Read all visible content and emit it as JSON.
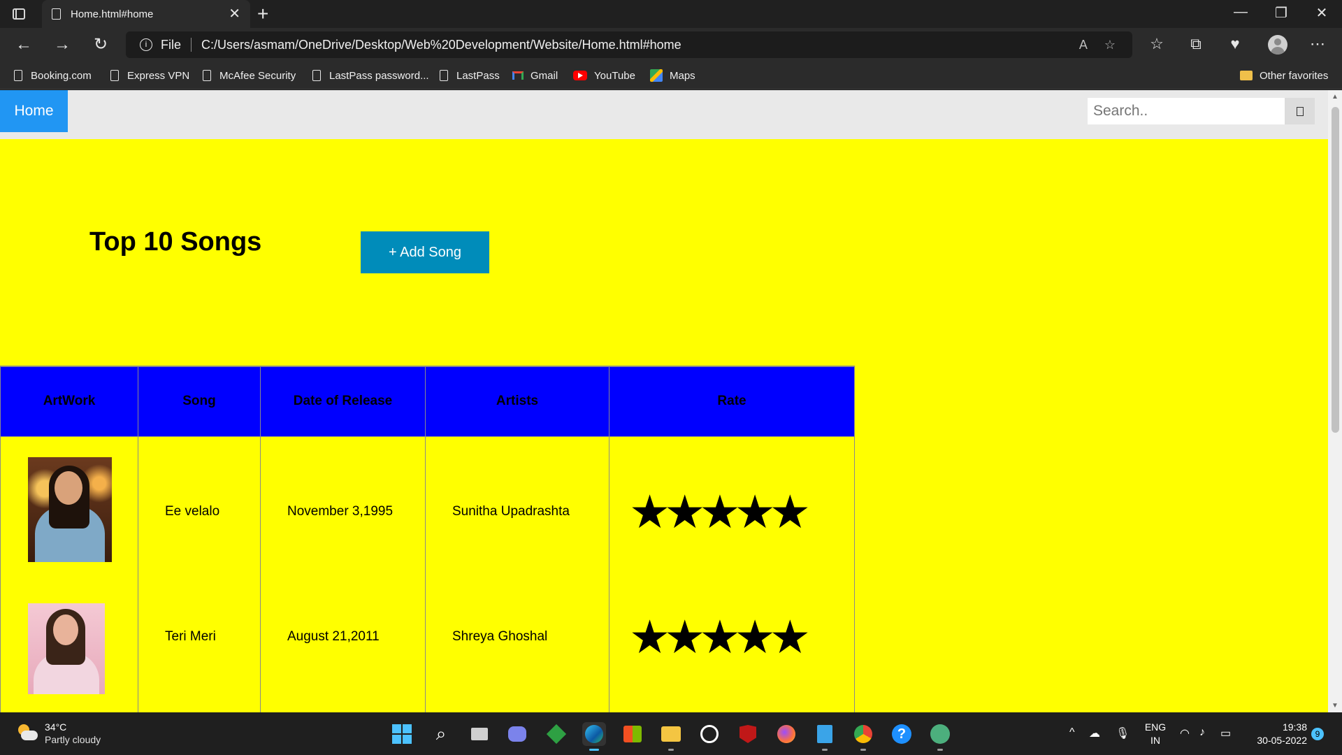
{
  "browser": {
    "tab_title": "Home.html#home",
    "tab_close": "✕",
    "new_tab": "+",
    "address_scheme": "File",
    "address_url": "C:/Users/asmam/OneDrive/Desktop/Web%20Development/Website/Home.html#home",
    "window_controls": [
      "—",
      "❐",
      "✕"
    ],
    "nav_icons": [
      "back-icon",
      "forward-icon",
      "refresh-icon"
    ],
    "favorites": [
      {
        "label": "Booking.com",
        "icon": "page-icon"
      },
      {
        "label": "Express VPN",
        "icon": "page-icon"
      },
      {
        "label": "McAfee Security",
        "icon": "page-icon"
      },
      {
        "label": "LastPass password...",
        "icon": "page-icon"
      },
      {
        "label": "LastPass",
        "icon": "page-icon"
      },
      {
        "label": "Gmail",
        "icon": "gmail-icon"
      },
      {
        "label": "YouTube",
        "icon": "youtube-icon"
      },
      {
        "label": "Maps",
        "icon": "maps-icon"
      }
    ],
    "other_favorites": "Other favorites"
  },
  "page": {
    "nav": {
      "home": "Home",
      "search_placeholder": "Search.."
    },
    "heading": "Top 10 Songs",
    "add_button": "+ Add Song",
    "table": {
      "headers": [
        "ArtWork",
        "Song",
        "Date of Release",
        "Artists",
        "Rate"
      ],
      "rows": [
        {
          "song": "Ee velalo",
          "date": "November 3,1995",
          "artist": "Sunitha Upadrashta",
          "rating": 5
        },
        {
          "song": "Teri Meri",
          "date": "August 21,2011",
          "artist": "Shreya Ghoshal",
          "rating": 5
        }
      ]
    }
  },
  "taskbar": {
    "weather_temp": "34°C",
    "weather_condition": "Partly cloudy",
    "language": "ENG",
    "region": "IN",
    "time": "19:38",
    "date": "30-05-2022",
    "notification_count": "9"
  },
  "colors": {
    "page_background": "#ffff00",
    "header_background": "#0000ff",
    "home_link": "#2196f3",
    "add_button": "#008cba"
  }
}
